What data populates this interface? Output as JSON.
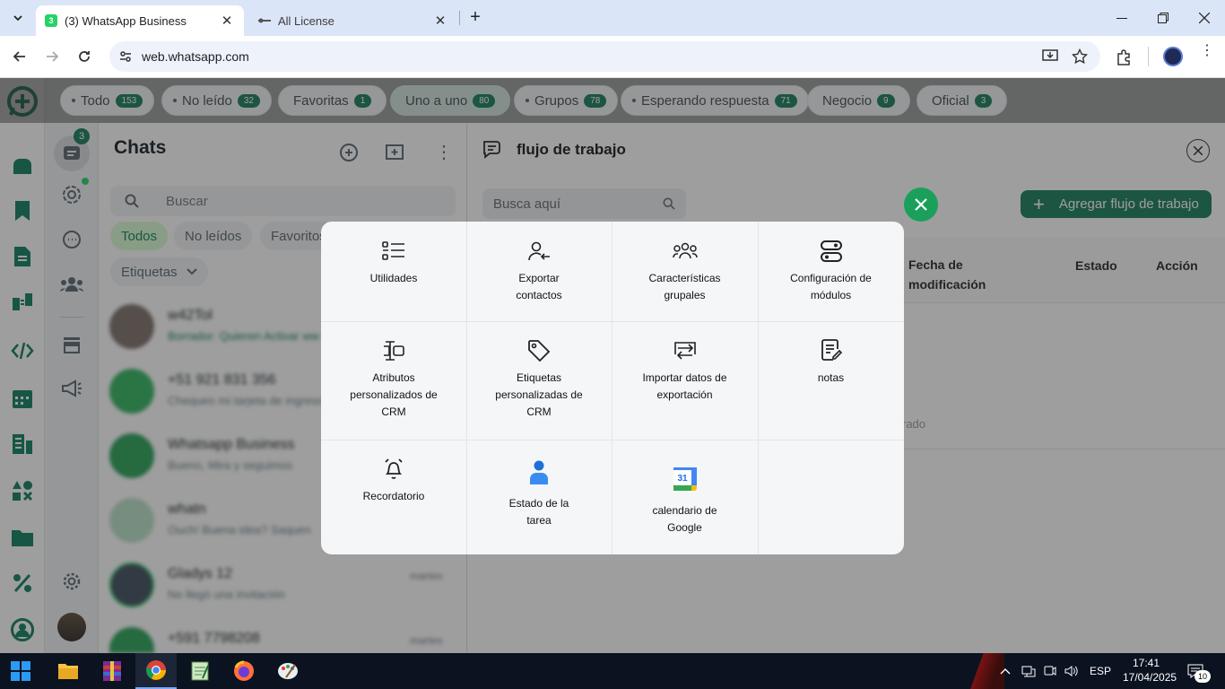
{
  "browser": {
    "tabs": [
      {
        "title": "(3) WhatsApp Business",
        "favicon_badge": "3"
      },
      {
        "title": "All License"
      }
    ],
    "url": "web.whatsapp.com"
  },
  "filters": [
    {
      "label": "Todo",
      "count": "153",
      "dot": true
    },
    {
      "label": "No leído",
      "count": "32",
      "dot": true
    },
    {
      "label": "Favoritas",
      "count": "1",
      "dot": false
    },
    {
      "label": "Uno a uno",
      "count": "80",
      "dot": false,
      "active": true
    },
    {
      "label": "Grupos",
      "count": "78",
      "dot": true
    },
    {
      "label": "Esperando respuesta",
      "count": "71",
      "dot": true
    },
    {
      "label": "Negocio",
      "count": "9",
      "dot": false
    },
    {
      "label": "Oficial",
      "count": "3",
      "dot": false
    }
  ],
  "nav": {
    "chats_badge": "3"
  },
  "chats": {
    "title": "Chats",
    "search_placeholder": "Buscar",
    "tabs": [
      "Todos",
      "No leídos",
      "Favoritos"
    ],
    "labels_dropdown": "Etiquetas",
    "items": [
      {
        "name": "w42Tol",
        "preview": "Borrador: Quieren Activar ww",
        "time": ""
      },
      {
        "name": "+51 921 831 356",
        "preview": "Chequeo mi tarjeta de ingreso",
        "time": ""
      },
      {
        "name": "Whatsapp Business",
        "preview": "Bueno, Mira y seguimos",
        "time": ""
      },
      {
        "name": "whatn",
        "preview": "Ouch! Buena idea? Saquen",
        "time": ""
      },
      {
        "name": "Gladys 12",
        "preview": "No llegó una invitación",
        "time": "martes"
      },
      {
        "name": "+591 7798208",
        "preview": "",
        "time": "martes"
      }
    ]
  },
  "workflow": {
    "title": "flujo de trabajo",
    "search_placeholder": "Busca aquí",
    "add_button": "Agregar flujo de trabajo",
    "columns": [
      "Fecha de modificación",
      "Estado",
      "Acción"
    ],
    "empty_fragment": "rado"
  },
  "menu": {
    "items": [
      {
        "label": "Utilidades",
        "icon": "list-icon"
      },
      {
        "label": "Exportar contactos",
        "icon": "user-export-icon"
      },
      {
        "label": "Características grupales",
        "icon": "group-icon"
      },
      {
        "label": "Configuración de módulos",
        "icon": "toggle-settings-icon"
      },
      {
        "label": "Atributos personalizados de CRM",
        "icon": "attribute-icon"
      },
      {
        "label": "Etiquetas personalizadas de CRM",
        "icon": "tag-icon"
      },
      {
        "label": "Importar datos de exportación",
        "icon": "import-export-icon"
      },
      {
        "label": "notas",
        "icon": "notes-icon"
      },
      {
        "label": "Recordatorio",
        "icon": "bell-icon"
      },
      {
        "label": "Estado de la tarea",
        "icon": "person-task-icon"
      },
      {
        "label": "calendario de Google",
        "icon": "google-calendar-icon"
      }
    ]
  },
  "taskbar": {
    "language": "ESP",
    "time": "17:41",
    "date": "17/04/2025",
    "notification_count": "10"
  },
  "colors": {
    "brand": "#0a7c5b",
    "accent": "#137a58",
    "close_fab": "#1aa05a"
  }
}
